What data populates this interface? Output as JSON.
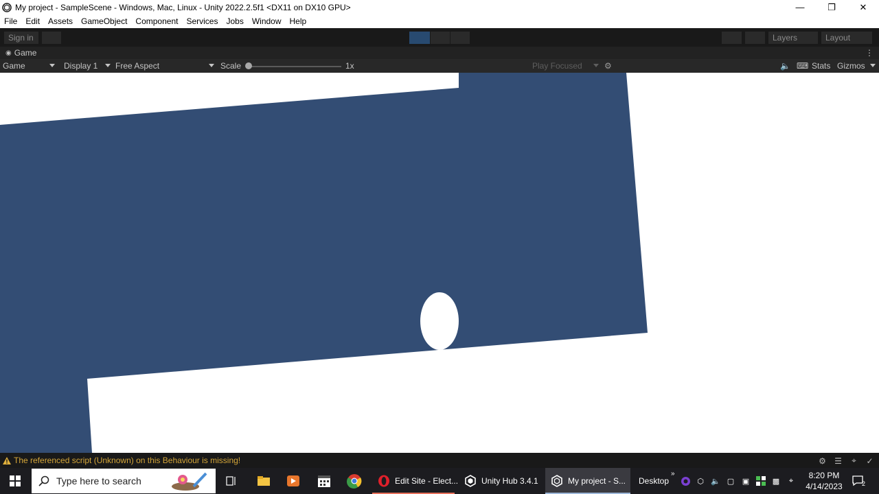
{
  "window": {
    "title": "My project - SampleScene - Windows, Mac, Linux - Unity 2022.2.5f1 <DX11 on DX10 GPU>"
  },
  "menu": [
    "File",
    "Edit",
    "Assets",
    "GameObject",
    "Component",
    "Services",
    "Jobs",
    "Window",
    "Help"
  ],
  "toolbar": {
    "sign_in": "Sign in",
    "layers": "Layers",
    "layout": "Layout"
  },
  "game_tab": {
    "label": "Game"
  },
  "game_bar": {
    "mode": "Game",
    "display": "Display 1",
    "aspect": "Free Aspect",
    "scale_label": "Scale",
    "scale_value": "1x",
    "play_focused": "Play Focused",
    "stats": "Stats",
    "gizmos": "Gizmos"
  },
  "scene": {
    "platform_color": "#334d74",
    "background_color": "#ffffff",
    "ball_color": "#ffffff"
  },
  "status": {
    "message": "The referenced script (Unknown) on this Behaviour is missing!",
    "warning_color": "#d6a73a"
  },
  "taskbar": {
    "search_placeholder": "Type here to search",
    "tasks": [
      {
        "label": "Edit Site - Elect..."
      },
      {
        "label": "Unity Hub 3.4.1"
      },
      {
        "label": "My project - S..."
      }
    ],
    "desktop": "Desktop",
    "time": "8:20 PM",
    "date": "4/14/2023",
    "notification_count": "2"
  }
}
